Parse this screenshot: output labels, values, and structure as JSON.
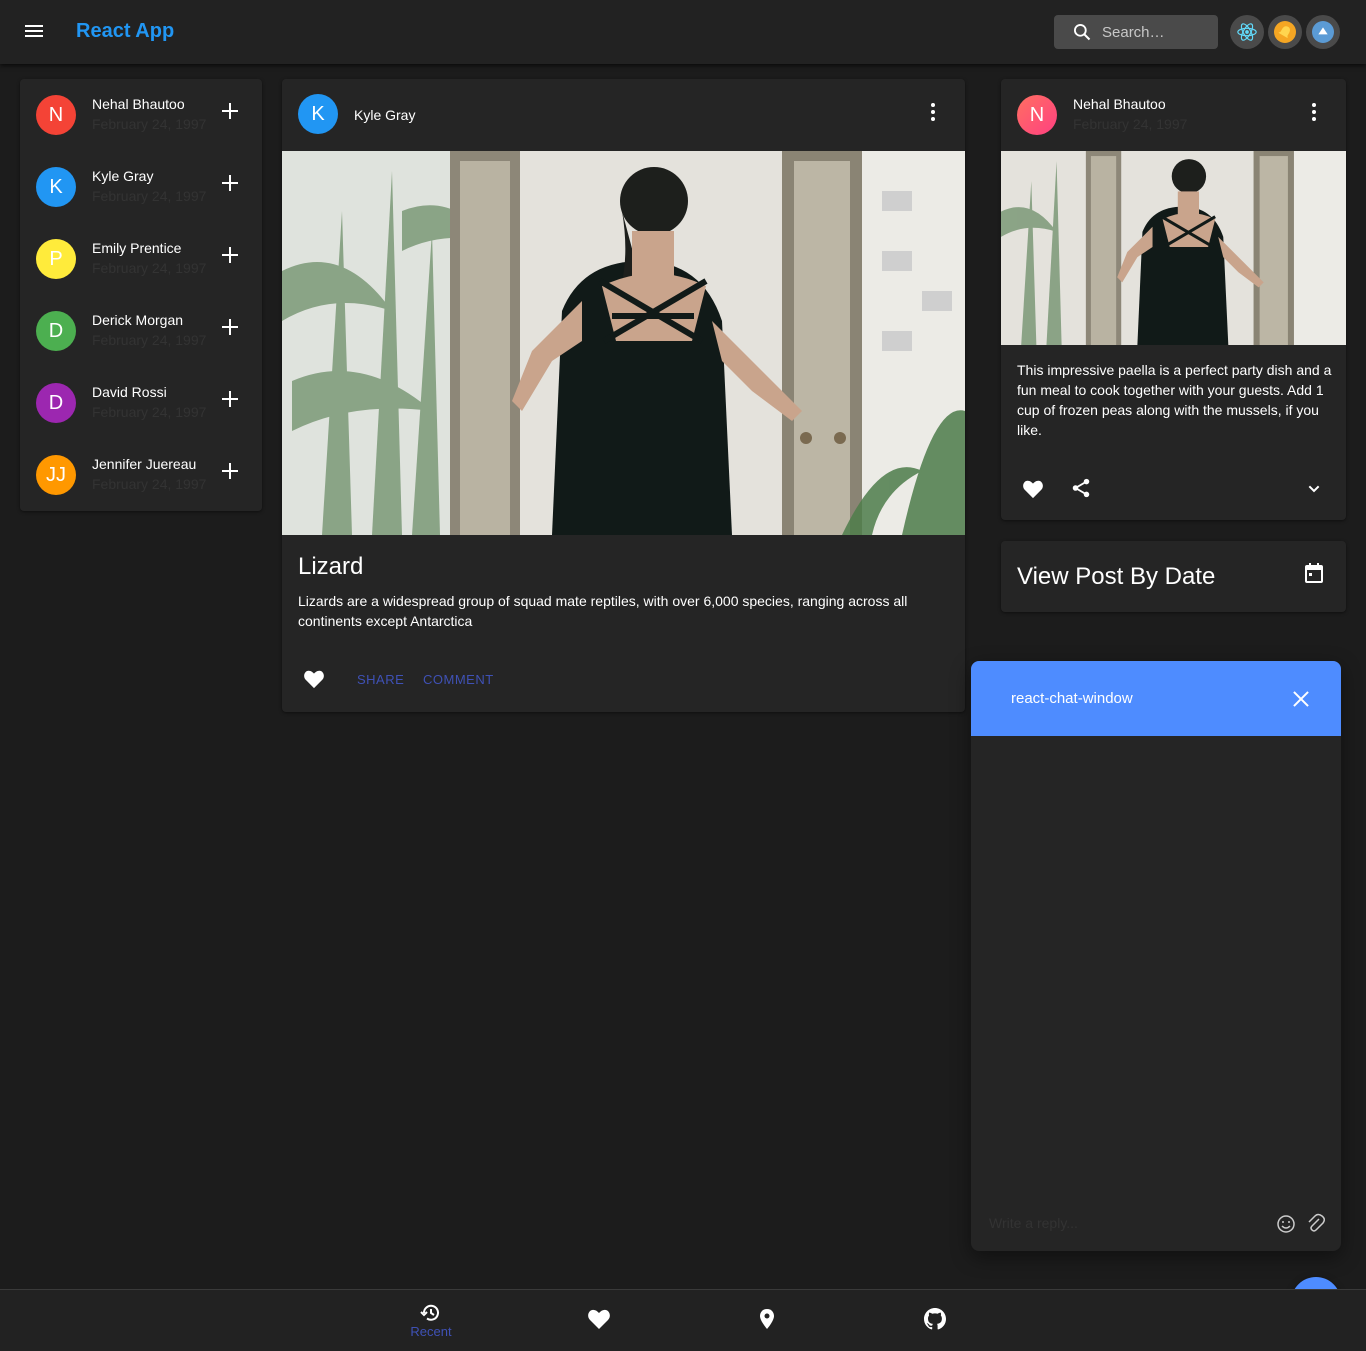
{
  "app": {
    "title": "React App"
  },
  "search": {
    "placeholder": "Search…"
  },
  "top_icons": [
    "react-icon",
    "bell-icon",
    "cloud-icon"
  ],
  "friends": [
    {
      "initials": "N",
      "name": "Nehal Bhautoo",
      "date": "February 24, 1997",
      "color": "#f44336"
    },
    {
      "initials": "K",
      "name": "Kyle Gray",
      "date": "February 24, 1997",
      "color": "#2196f3"
    },
    {
      "initials": "P",
      "name": "Emily Prentice",
      "date": "February 24, 1997",
      "color": "#ffeb3b"
    },
    {
      "initials": "D",
      "name": "Derick Morgan",
      "date": "February 24, 1997",
      "color": "#4caf50"
    },
    {
      "initials": "D",
      "name": "David Rossi",
      "date": "February 24, 1997",
      "color": "#9c27b0"
    },
    {
      "initials": "JJ",
      "name": "Jennifer Juereau",
      "date": "February 24, 1997",
      "color": "#ff9800"
    }
  ],
  "main_post": {
    "author_initial": "K",
    "author": "Kyle Gray",
    "title": "Lizard",
    "body": "Lizards are a widespread group of squad mate reptiles, with over 6,000 species, ranging across all continents except Antarctica",
    "share_label": "SHARE",
    "comment_label": "COMMENT"
  },
  "side_post": {
    "author_initial": "N",
    "author": "Nehal Bhautoo",
    "date": "February 24, 1997",
    "body": "This impressive paella is a perfect party dish and a fun meal to cook together with your guests. Add 1 cup of frozen peas along with the mussels, if you like."
  },
  "date_card": {
    "title": "View Post By Date"
  },
  "chat": {
    "title": "react-chat-window",
    "placeholder": "Write a reply..."
  },
  "bottom_nav": {
    "recent_label": "Recent"
  },
  "colors": {
    "accent": "#2196f3",
    "chat_blue": "#4e8cff",
    "nav_active": "#3f51b5"
  }
}
